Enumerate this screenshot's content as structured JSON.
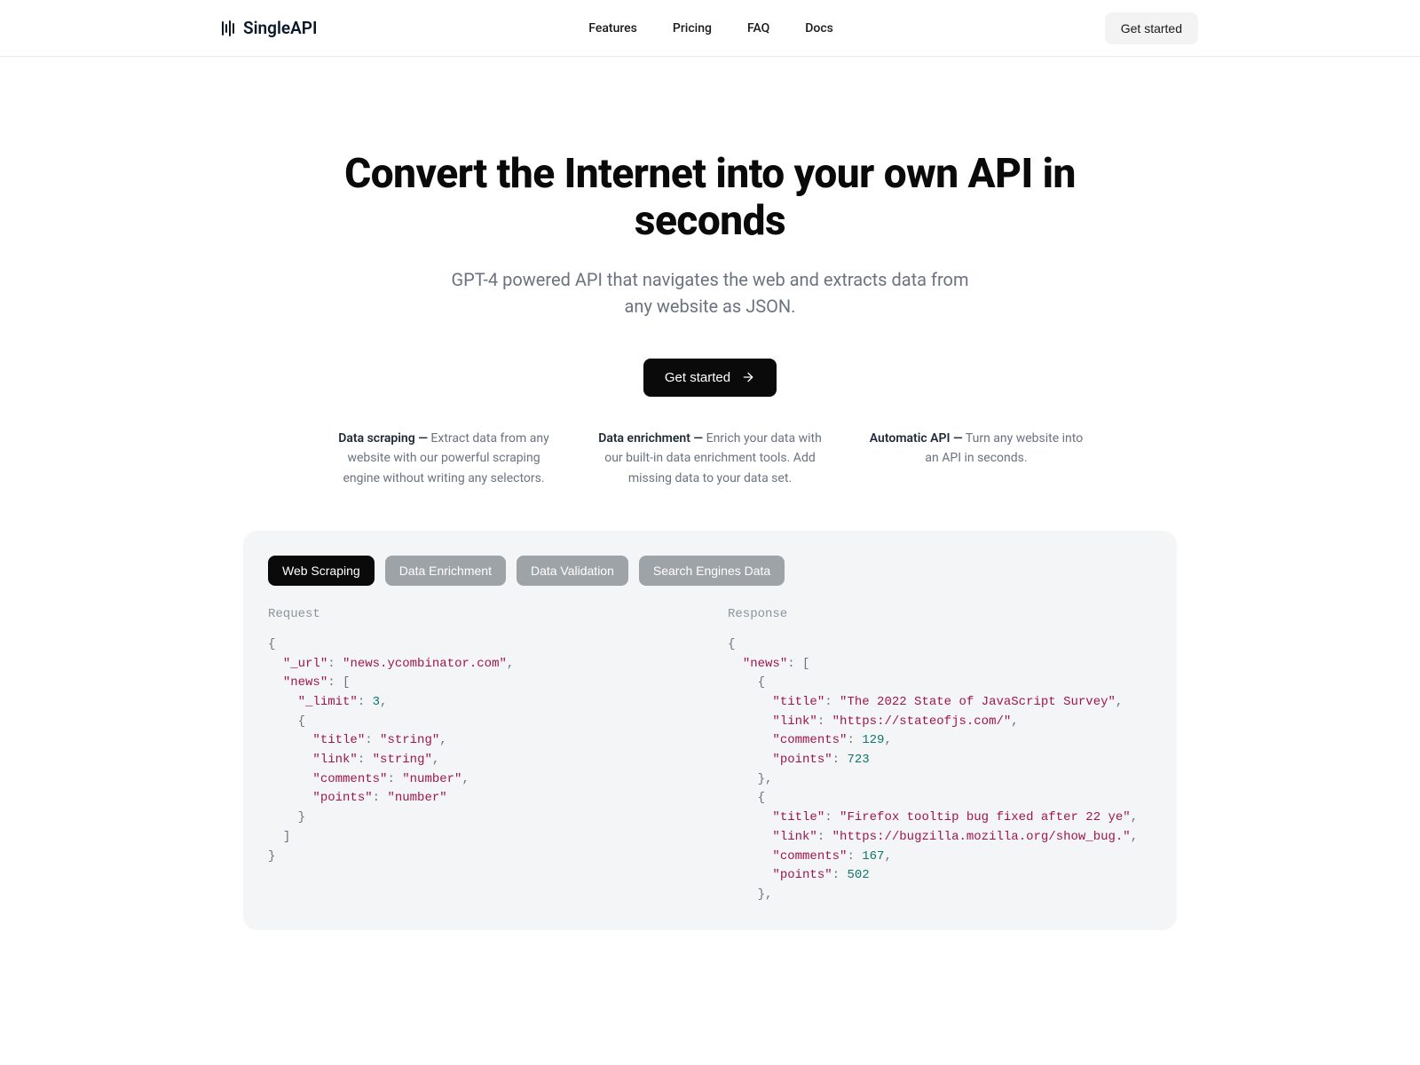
{
  "header": {
    "brand": "SingleAPI",
    "nav": [
      "Features",
      "Pricing",
      "FAQ",
      "Docs"
    ],
    "cta": "Get started"
  },
  "hero": {
    "title": "Convert the Internet into your own API in seconds",
    "subtitle": "GPT-4 powered API that navigates the web and extracts data from any website as JSON.",
    "cta": "Get started"
  },
  "features": [
    {
      "title": "Data scraping",
      "desc": "Extract data from any website with our powerful scraping engine without writing any selectors."
    },
    {
      "title": "Data enrichment",
      "desc": "Enrich your data with our built-in data enrichment tools. Add missing data to your data set."
    },
    {
      "title": "Automatic API",
      "desc": "Turn any website into an API in seconds."
    }
  ],
  "code_card": {
    "tabs": [
      "Web Scraping",
      "Data Enrichment",
      "Data Validation",
      "Search Engines Data"
    ],
    "active_tab": 0,
    "request_label": "Request",
    "response_label": "Response",
    "request": {
      "_url": "news.ycombinator.com",
      "news": {
        "_limit": 3,
        "schema": {
          "title": "string",
          "link": "string",
          "comments": "number",
          "points": "number"
        }
      }
    },
    "response": {
      "news": [
        {
          "title": "The 2022 State of JavaScript Survey",
          "link": "https://stateofjs.com/",
          "comments": 129,
          "points": 723
        },
        {
          "title": "Firefox tooltip bug fixed after 22 ye",
          "link": "https://bugzilla.mozilla.org/show_bug.",
          "comments": 167,
          "points": 502
        }
      ]
    }
  }
}
